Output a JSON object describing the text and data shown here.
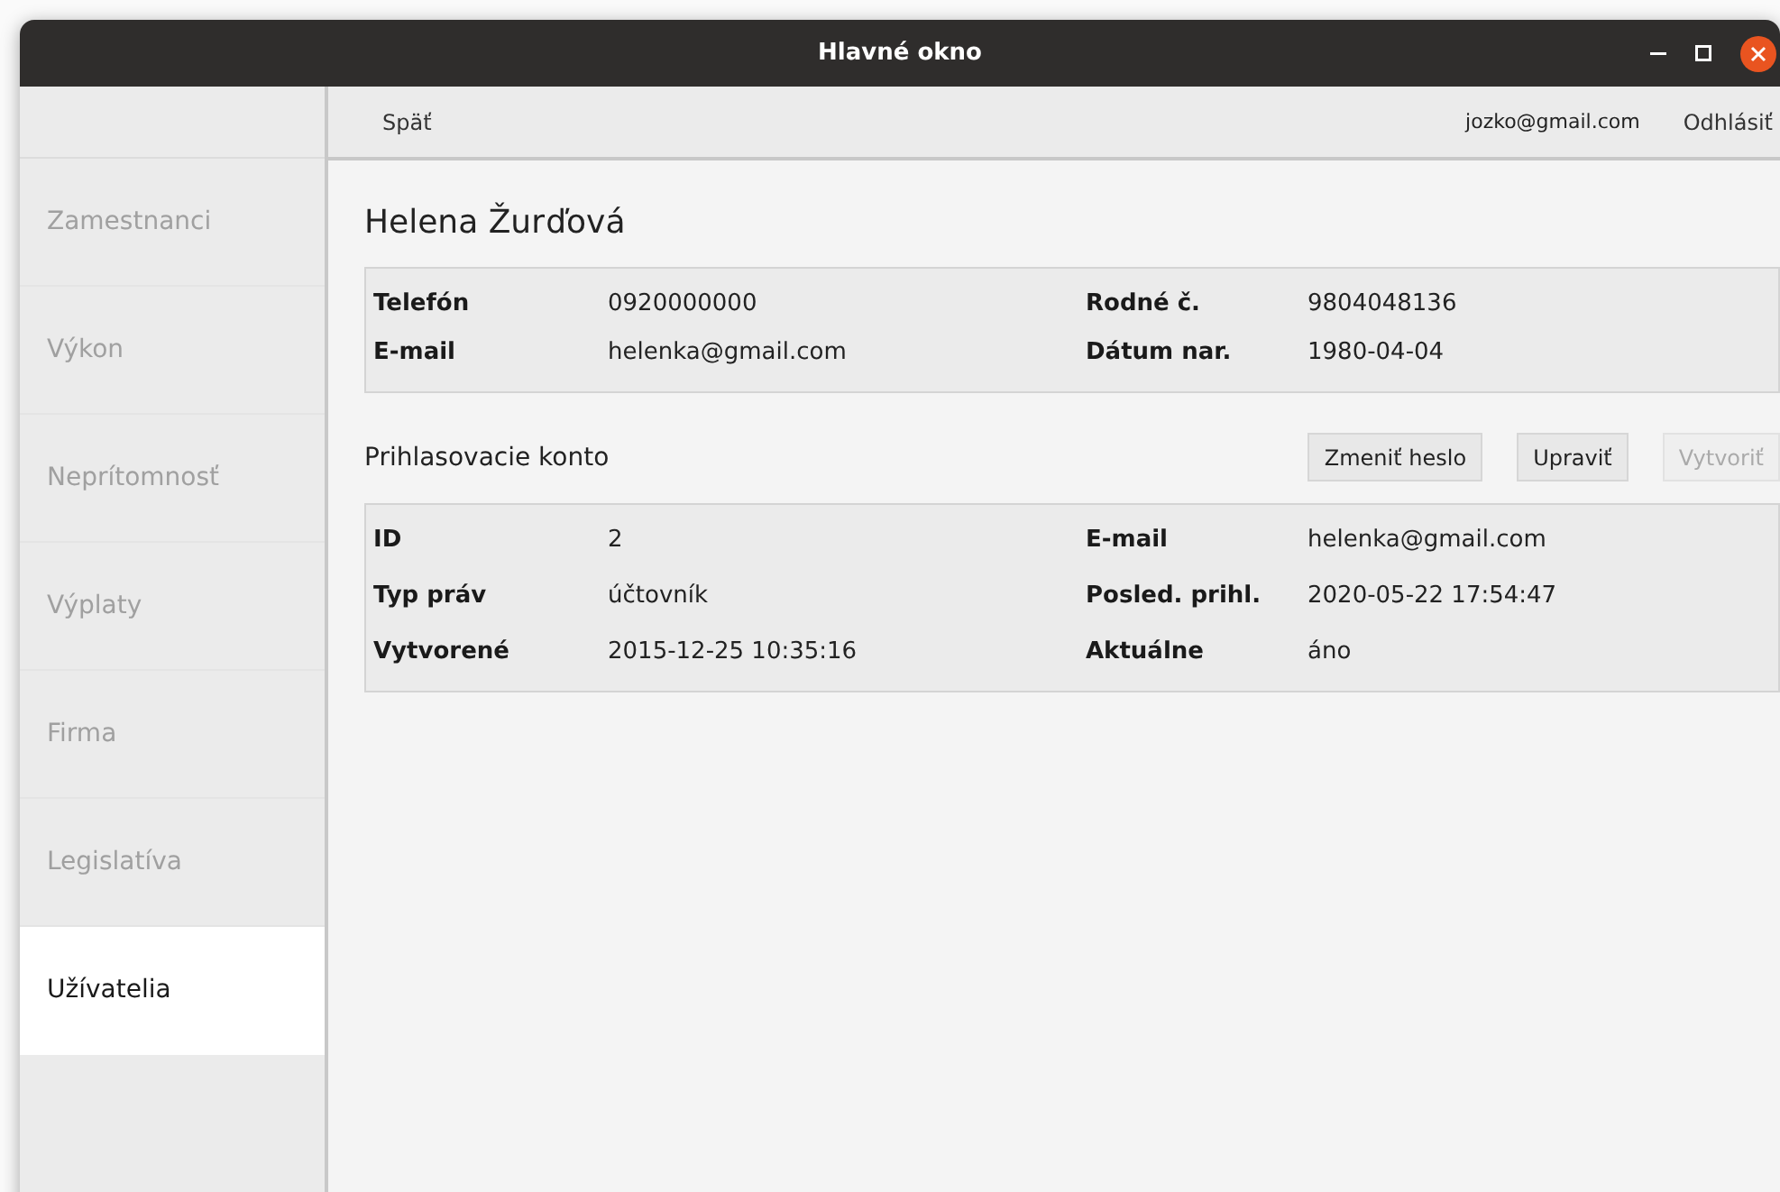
{
  "window": {
    "title": "Hlavné okno"
  },
  "toolbar": {
    "back": "Späť",
    "user": "jozko@gmail.com",
    "logout": "Odhlásiť"
  },
  "sidebar": {
    "items": [
      {
        "label": "Zamestnanci",
        "selected": false
      },
      {
        "label": "Výkon",
        "selected": false
      },
      {
        "label": "Neprítomnosť",
        "selected": false
      },
      {
        "label": "Výplaty",
        "selected": false
      },
      {
        "label": "Firma",
        "selected": false
      },
      {
        "label": "Legislatíva",
        "selected": false
      },
      {
        "label": "Užívatelia",
        "selected": true
      }
    ]
  },
  "person": {
    "name": "Helena Žurďová",
    "fields": [
      {
        "label": "Telefón",
        "value": "0920000000"
      },
      {
        "label": "Rodné č.",
        "value": "9804048136"
      },
      {
        "label": "E-mail",
        "value": "helenka@gmail.com"
      },
      {
        "label": "Dátum nar.",
        "value": "1980-04-04"
      }
    ]
  },
  "account": {
    "title": "Prihlasovacie konto",
    "buttons": [
      {
        "label": "Zmeniť heslo",
        "disabled": false
      },
      {
        "label": "Upraviť",
        "disabled": false
      },
      {
        "label": "Vytvoriť",
        "disabled": true
      }
    ],
    "fields": [
      {
        "label": "ID",
        "value": "2"
      },
      {
        "label": "E-mail",
        "value": "helenka@gmail.com"
      },
      {
        "label": "Typ práv",
        "value": "účtovník"
      },
      {
        "label": "Posled. prihl.",
        "value": "2020-05-22 17:54:47"
      },
      {
        "label": "Vytvorené",
        "value": "2015-12-25 10:35:16"
      },
      {
        "label": "Aktuálne",
        "value": "áno"
      }
    ]
  }
}
